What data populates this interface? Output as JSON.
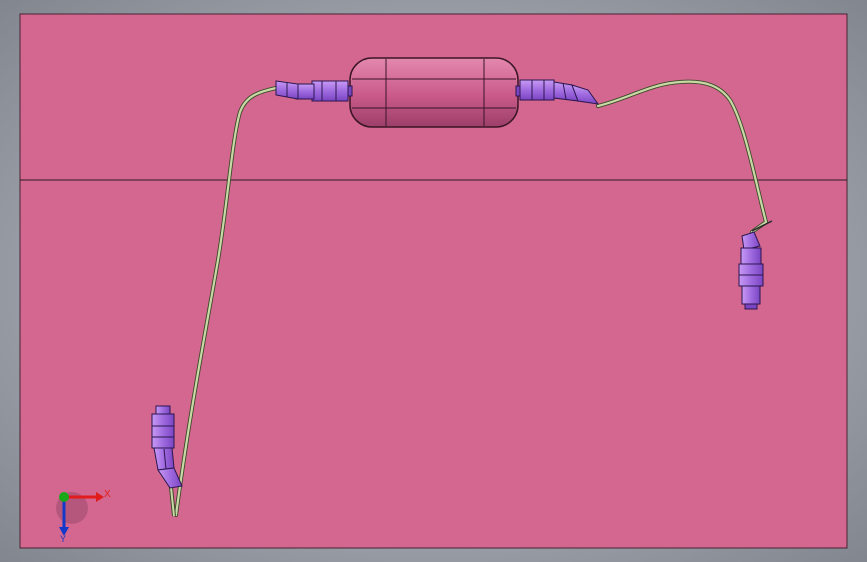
{
  "viewport": {
    "background_color": "#d4678f",
    "frame_color": "#8a8f98",
    "horizontal_divider": true
  },
  "model": {
    "cable_color": "#c9d9a6",
    "connector_color": "#a06be0",
    "enclosure_color": "#c95a8a"
  },
  "triad": {
    "x_label": "X",
    "y_label": "Y",
    "x_color": "#e11c1c",
    "y_color": "#1438c8",
    "z_color": "#18a818"
  }
}
